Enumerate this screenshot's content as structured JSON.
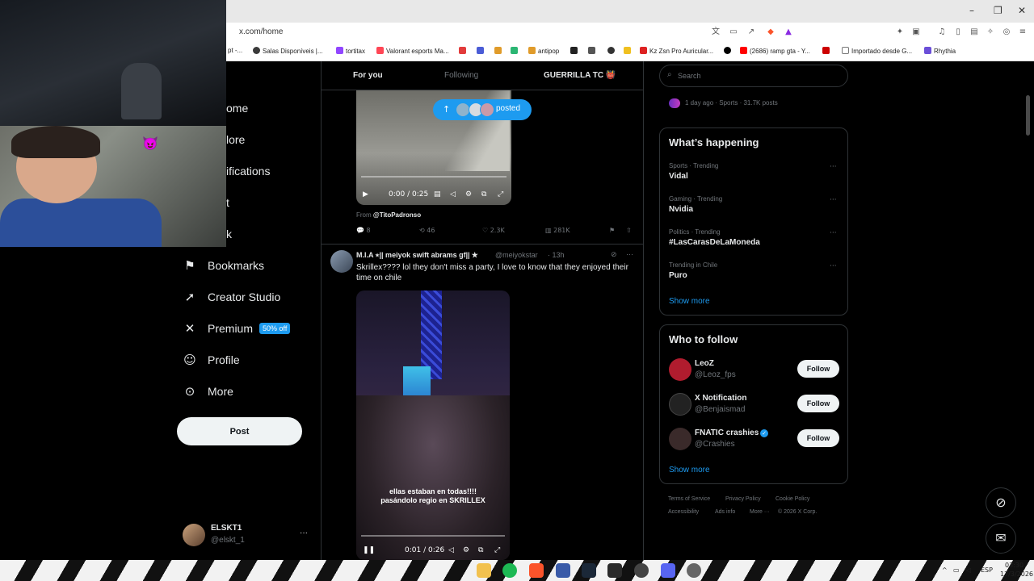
{
  "browser": {
    "url": "x.com/home",
    "window_controls": [
      "–",
      "❐",
      "✕"
    ],
    "bookmarks": [
      {
        "label": "pt -...",
        "color": "#ffffff"
      },
      {
        "label": "Salas Disponíveis |...",
        "color": "#3a3a3a"
      },
      {
        "label": "tortitax",
        "color": "#9146ff"
      },
      {
        "label": "Valorant esports Ma...",
        "color": "#ff4655"
      },
      {
        "label": "",
        "color": "#e23b3b"
      },
      {
        "label": "",
        "color": "#4a5cd6"
      },
      {
        "label": "",
        "color": "#2bb673"
      },
      {
        "label": "antipop",
        "color": "#e09b2a"
      },
      {
        "label": "",
        "color": "#222222"
      },
      {
        "label": "",
        "color": "#555555"
      },
      {
        "label": "",
        "color": "#333333"
      },
      {
        "label": "",
        "color": "#f0c020"
      },
      {
        "label": "Kz Zsn Pro Auricular...",
        "color": "#d22"
      },
      {
        "label": "",
        "color": "#000000"
      },
      {
        "label": "(2686) ramp gta - Y...",
        "color": "#ff0000"
      },
      {
        "label": "",
        "color": "#c00"
      },
      {
        "label": "Importado desde G...",
        "color": "#777777"
      },
      {
        "label": "Rhythia",
        "color": "#6b4fd8"
      }
    ]
  },
  "webcam": {
    "emoji": "😈"
  },
  "sidebar": {
    "partial_items": [
      "ome",
      "lore",
      "ifications",
      "t",
      "k"
    ],
    "items": [
      {
        "icon": "bookmark-icon",
        "glyph": "⚑",
        "label": "Bookmarks"
      },
      {
        "icon": "rocket-icon",
        "glyph": "➚",
        "label": "Creator Studio"
      },
      {
        "icon": "x-logo-icon",
        "glyph": "✕",
        "label": "Premium",
        "badge": "50% off"
      },
      {
        "icon": "person-icon",
        "glyph": "☺",
        "label": "Profile"
      },
      {
        "icon": "more-circle-icon",
        "glyph": "⊙",
        "label": "More"
      }
    ],
    "post_label": "Post",
    "account": {
      "name": "ELSKT1",
      "handle": "@elskt_1",
      "more": "···"
    }
  },
  "feed": {
    "tabs": [
      "For you",
      "Following",
      "GUERRILLA TC 👹"
    ],
    "posted_label": "posted",
    "post1": {
      "time": "0:00 / 0:25",
      "from_prefix": "From",
      "from_handle": "@TitoPadronso",
      "replies": "8",
      "reposts": "46",
      "likes": "2.3K",
      "views": "281K"
    },
    "post2": {
      "author": "M.I.A ⭑|| meiyok swift abrams gf|| ★",
      "handle": "@meiyokstar",
      "time": "· 13h",
      "text": "Skrillex???? lol they don't miss a party, I love to know that they enjoyed their time on chile",
      "caption_line1": "ellas estaban en todas!!!!",
      "caption_line2": "pasándolo regio en SKRILLEX",
      "video_time": "0:01 / 0:26"
    }
  },
  "right": {
    "search_placeholder": "Search",
    "top_meta": "1 day ago · Sports · 31.7K posts",
    "happening_title": "What’s happening",
    "trends": [
      {
        "meta": "Sports · Trending",
        "name": "Vidal"
      },
      {
        "meta": "Gaming · Trending",
        "name": "Nvidia"
      },
      {
        "meta": "Politics · Trending",
        "name": "#LasCarasDeLaMoneda"
      },
      {
        "meta": "Trending in Chile",
        "name": "Puro"
      }
    ],
    "show_more": "Show more",
    "wtf_title": "Who to follow",
    "follow_label": "Follow",
    "wtf": [
      {
        "name": "LeoZ",
        "handle": "@Leoz_fps",
        "color": "#b01c2e"
      },
      {
        "name": "X Notification",
        "handle": "@Benjaismad",
        "color": "#222222"
      },
      {
        "name": "FNATIC crashies",
        "handle": "@Crashies",
        "color": "#3a2a2a"
      }
    ],
    "footer": [
      "Terms of Service",
      "Privacy Policy",
      "Cookie Policy",
      "Accessibility",
      "Ads info",
      "More ···",
      "© 2026 X Corp."
    ]
  },
  "taskbar": {
    "lang": "ESP",
    "time": "03:30",
    "date": "17/3/2026"
  }
}
